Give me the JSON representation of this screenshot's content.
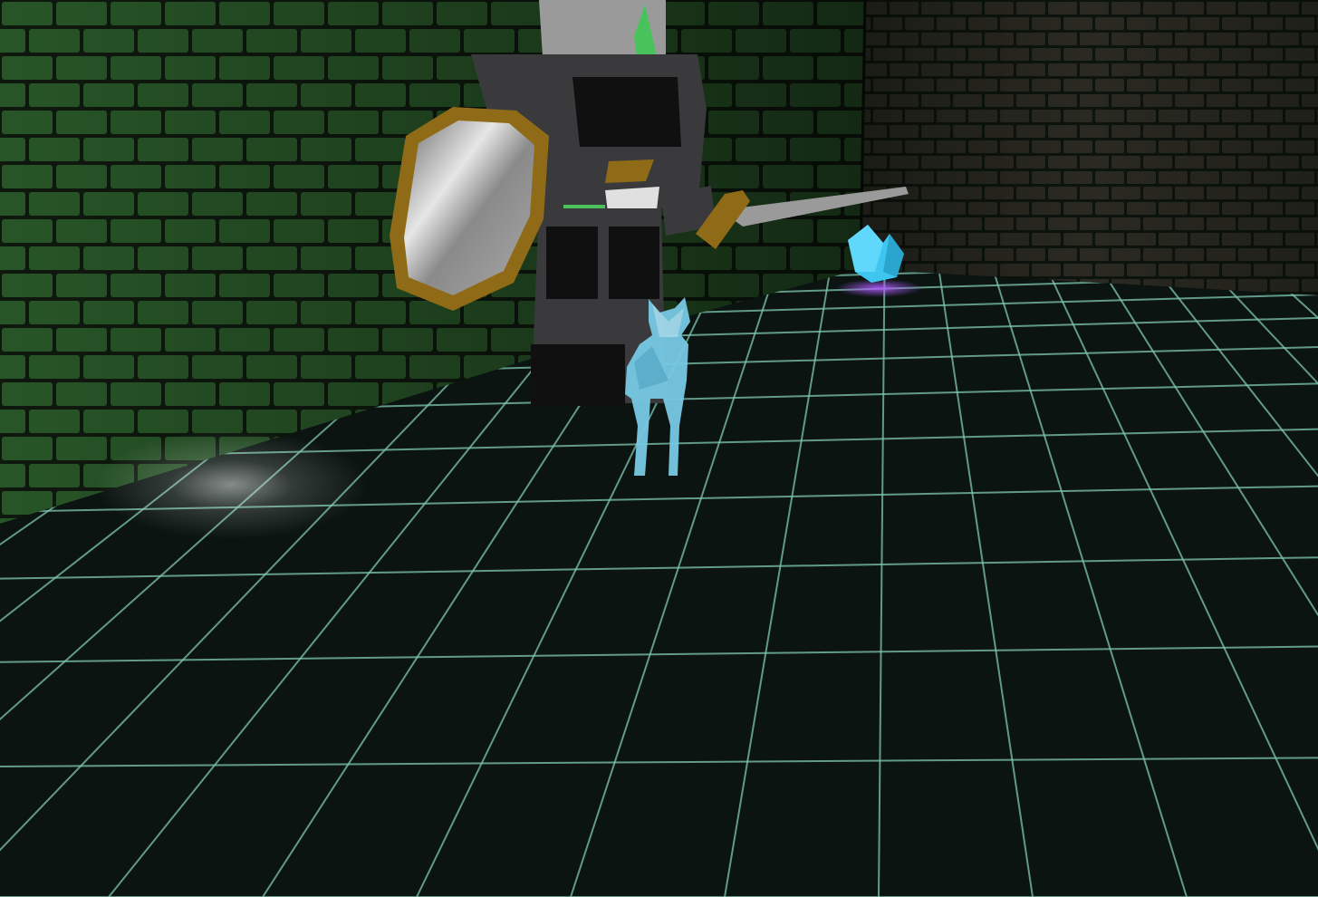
{
  "scene": {
    "colors": {
      "wall_left_brick": "#2a5a2a",
      "wall_left_mortar": "#0f1a0f",
      "wall_back_brick": "#2a2a22",
      "wall_back_mortar": "#0d140d",
      "floor_tile": "#0c1412",
      "floor_grid": "#7fc7b0",
      "floor_highlight": "#d8e0dc",
      "knight_armor": "#3a3a3c",
      "knight_armor_dark": "#101010",
      "knight_silver": "#9a9a9a",
      "knight_gold": "#8f6b17",
      "knight_plume": "#49c25b",
      "wolf": "#78c9e4",
      "crystal": "#3fc6f0",
      "crystal_glow": "#a048e0"
    }
  }
}
